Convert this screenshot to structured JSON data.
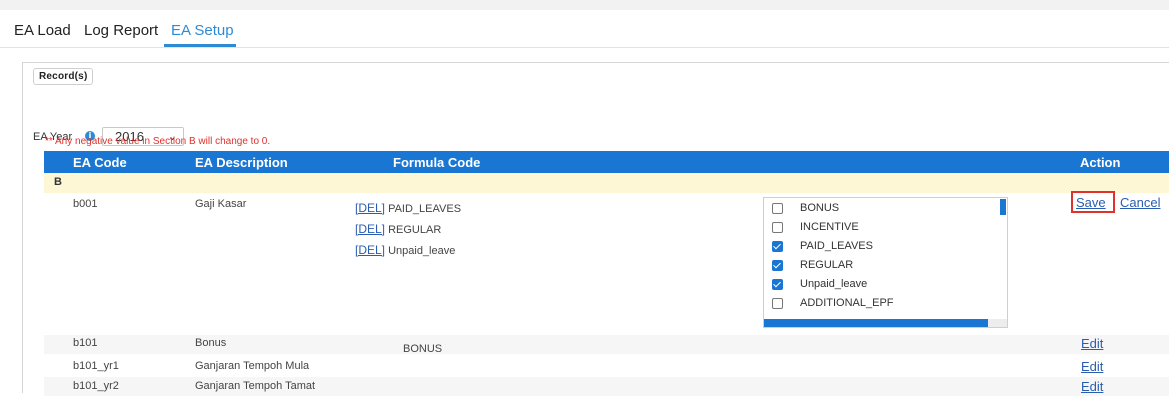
{
  "tabs": [
    {
      "label": "EA Load"
    },
    {
      "label": "Log Report"
    },
    {
      "label": "EA Setup",
      "active": true
    }
  ],
  "panel": {
    "legend": "Record(s)"
  },
  "filter": {
    "year_label": "EA Year",
    "info_icon": "i",
    "year_value": "2016",
    "year_chevron": "⌄"
  },
  "note": "** Any negative value in Section B will change to 0.",
  "table": {
    "headers": {
      "code": "EA Code",
      "description": "EA Description",
      "formula": "Formula Code",
      "action": "Action"
    },
    "section": "B",
    "edit_row": {
      "code": "b001",
      "description": "Gaji Kasar",
      "del_label": "[DEL]",
      "formula_items": [
        "PAID_LEAVES",
        "REGULAR",
        "Unpaid_leave"
      ],
      "options": [
        {
          "label": "BONUS",
          "checked": false
        },
        {
          "label": "INCENTIVE",
          "checked": false
        },
        {
          "label": "PAID_LEAVES",
          "checked": true
        },
        {
          "label": "REGULAR",
          "checked": true
        },
        {
          "label": "Unpaid_leave",
          "checked": true
        },
        {
          "label": "ADDITIONAL_EPF",
          "checked": false
        }
      ],
      "save_label": "Save",
      "cancel_label": "Cancel"
    },
    "rows": [
      {
        "code": "b101",
        "description": "Bonus",
        "formula": "BONUS",
        "action": "Edit"
      },
      {
        "code": "b101_yr1",
        "description": "Ganjaran Tempoh Mula",
        "formula": "",
        "action": "Edit"
      },
      {
        "code": "b101_yr2",
        "description": "Ganjaran Tempoh Tamat",
        "formula": "",
        "action": "Edit"
      }
    ]
  },
  "colors": {
    "accent": "#2d8bd6",
    "header_bg": "#1976d2",
    "section_bg": "#fdf7d6",
    "warning": "#e0312b",
    "link": "#2a5db0"
  }
}
